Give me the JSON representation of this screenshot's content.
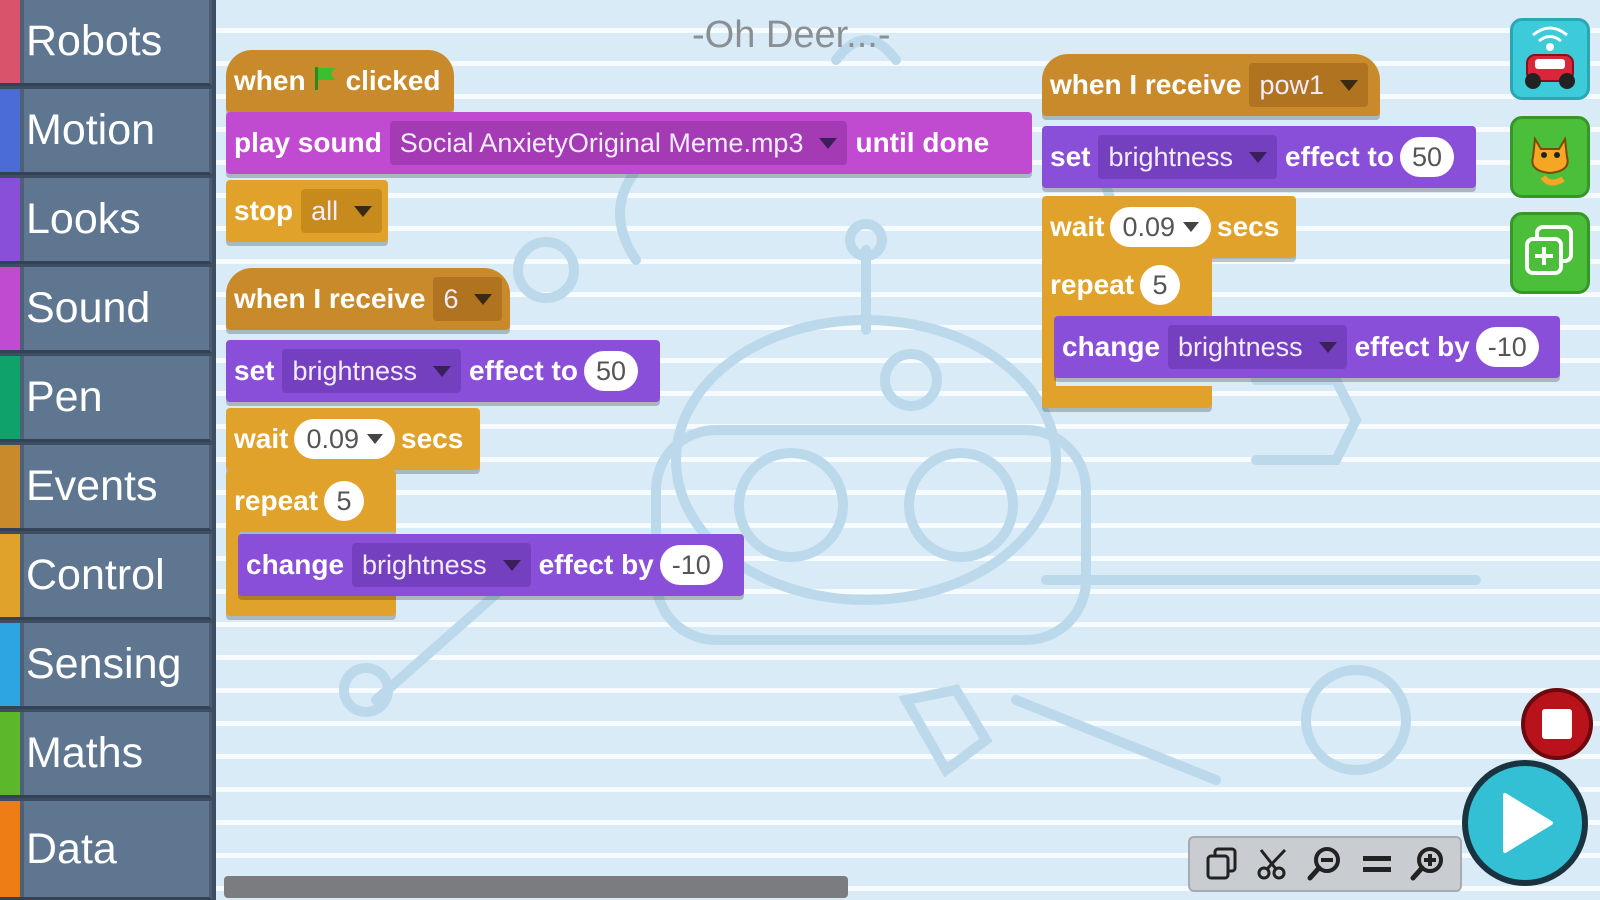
{
  "sidebar": {
    "categories": [
      {
        "label": "Robots",
        "color": "#d9536b"
      },
      {
        "label": "Motion",
        "color": "#4a6cd4"
      },
      {
        "label": "Looks",
        "color": "#8a4fd8"
      },
      {
        "label": "Sound",
        "color": "#c04bd0"
      },
      {
        "label": "Pen",
        "color": "#0fa36b"
      },
      {
        "label": "Events",
        "color": "#c98a2c"
      },
      {
        "label": "Control",
        "color": "#e0a22a"
      },
      {
        "label": "Sensing",
        "color": "#2ca5e2"
      },
      {
        "label": "Maths",
        "color": "#5cb82a"
      },
      {
        "label": "Data",
        "color": "#ee7d16"
      }
    ]
  },
  "workspace": {
    "project_title": "-Oh Deer...-"
  },
  "script1": {
    "hat_when": "when",
    "hat_clicked": "clicked",
    "play_label": "play sound",
    "sound_name": "Social AnxietyOriginal Meme.mp3",
    "until_done": "until done",
    "stop_label": "stop",
    "stop_value": "all"
  },
  "script2": {
    "hat_label": "when I receive",
    "message": "6",
    "set_label": "set",
    "set_effect": "brightness",
    "effect_to": "effect to",
    "set_value": "50",
    "wait_label": "wait",
    "wait_value": "0.09",
    "secs_label": "secs",
    "repeat_label": "repeat",
    "repeat_value": "5",
    "change_label": "change",
    "change_effect": "brightness",
    "effect_by": "effect by",
    "change_value": "-10"
  },
  "script3": {
    "hat_label": "when I receive",
    "message": "pow1",
    "set_label": "set",
    "set_effect": "brightness",
    "effect_to": "effect to",
    "set_value": "50",
    "wait_label": "wait",
    "wait_value": "0.09",
    "secs_label": "secs",
    "repeat_label": "repeat",
    "repeat_value": "5",
    "change_label": "change",
    "change_effect": "brightness",
    "effect_by": "effect by",
    "change_value": "-10"
  },
  "tools": {
    "robot_icon": "robot-car-icon",
    "sprite_icon": "cat-sprite-icon",
    "duplicate_icon": "duplicate-add-icon",
    "stop_icon": "stop-icon",
    "go_icon": "play-icon",
    "toolbar_icons": [
      "copy-icon",
      "cut-icon",
      "zoom-out-icon",
      "zoom-reset-icon",
      "zoom-in-icon"
    ]
  }
}
